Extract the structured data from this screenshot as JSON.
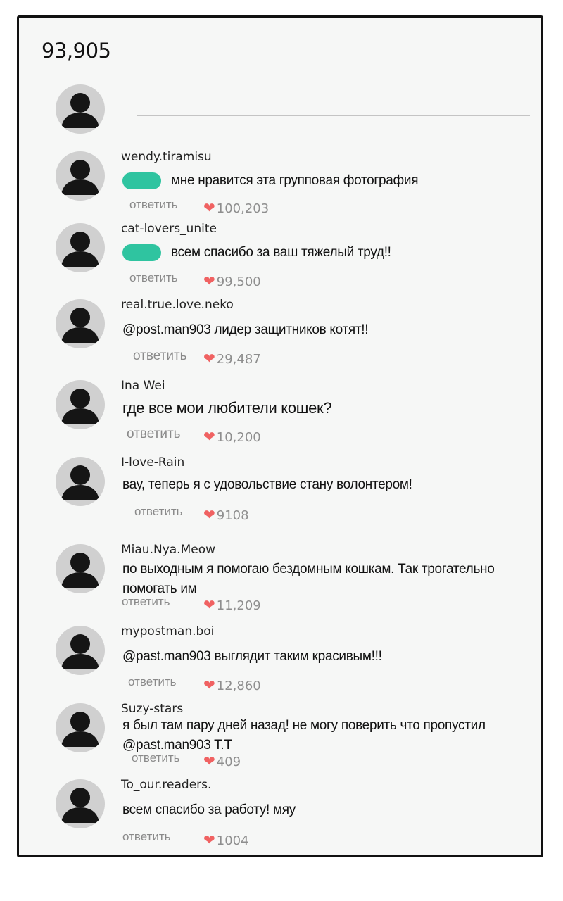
{
  "header": {
    "count": "93,905"
  },
  "compose": {
    "placeholder": ""
  },
  "comments": [
    {
      "user": "wendy.tiramisu",
      "has_pill": true,
      "text": "мне нравится эта групповая фотография",
      "reply": "ответить",
      "likes": "100,203"
    },
    {
      "user": "cat-lovers_unite",
      "has_pill": true,
      "text": "всем спасибо за ваш тяжелый труд!!",
      "reply": "ответить",
      "likes": "99,500"
    },
    {
      "user": "real.true.love.neko",
      "has_pill": false,
      "text": "@post.man903 лидер защитников котят!!",
      "reply": "ответить",
      "likes": "29,487"
    },
    {
      "user": "Ina Wei",
      "has_pill": false,
      "text": "где все мои любители кошек?",
      "reply": "ответить",
      "likes": "10,200"
    },
    {
      "user": "I-love-Rain",
      "has_pill": false,
      "text": "вау, теперь я с удовольствие стану волонтером!",
      "reply": "ответить",
      "likes": "9108"
    },
    {
      "user": "Miau.Nya.Meow",
      "has_pill": false,
      "text": "по выходным я помогаю бездомным кошкам. Так трогательно помогать им",
      "reply": "ответить",
      "likes": "11,209"
    },
    {
      "user": "mypostman.boi",
      "has_pill": false,
      "text": "@past.man903 выглядит таким красивым!!!",
      "reply": "ответить",
      "likes": "12,860"
    },
    {
      "user": "Suzy-stars",
      "has_pill": false,
      "text": "я был там пару дней назад! не могу поверить что пропустил @past.man903 T.T",
      "reply": "ответить",
      "likes": "409"
    },
    {
      "user": "To_our.readers.",
      "has_pill": false,
      "text": "всем спасибо за работу! мяу",
      "reply": "ответить",
      "likes": "1004"
    }
  ],
  "icons": {
    "avatar": "user-silhouette-icon",
    "like": "heart-icon"
  },
  "colors": {
    "pill": "#2fc4a0",
    "heart": "#f06262",
    "muted": "#8a8a8a"
  }
}
